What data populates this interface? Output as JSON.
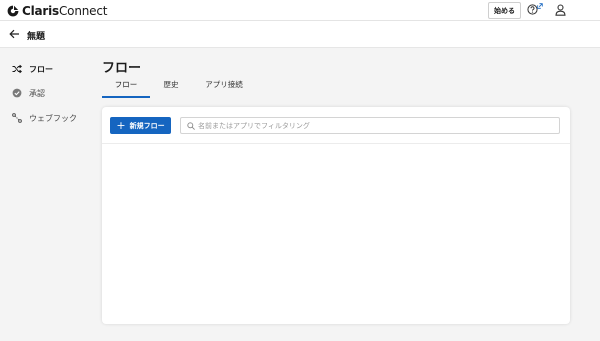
{
  "brand": {
    "name_bold": "Claris",
    "name_regular": "Connect",
    "logo_icon": "claris-logo-icon"
  },
  "header": {
    "start_label": "始める",
    "help_icon": "help-circle-icon",
    "external_icon": "external-link-icon",
    "user_icon": "user-icon"
  },
  "subheader": {
    "back_icon": "arrow-left-icon",
    "title": "無題"
  },
  "sidebar": {
    "items": [
      {
        "label": "フロー",
        "icon": "shuffle-icon",
        "active": true
      },
      {
        "label": "承認",
        "icon": "check-circle-icon",
        "active": false
      },
      {
        "label": "ウェブフック",
        "icon": "webhook-icon",
        "active": false
      }
    ]
  },
  "main": {
    "title": "フロー",
    "tabs": [
      {
        "label": "フロー",
        "active": true
      },
      {
        "label": "歴史",
        "active": false
      },
      {
        "label": "アプリ接続",
        "active": false
      }
    ],
    "new_flow_label": "新規フロー",
    "search": {
      "placeholder": "名前またはアプリでフィルタリング",
      "value": ""
    }
  },
  "colors": {
    "accent": "#1565c0",
    "background": "#f4f4f4",
    "panel": "#ffffff"
  }
}
